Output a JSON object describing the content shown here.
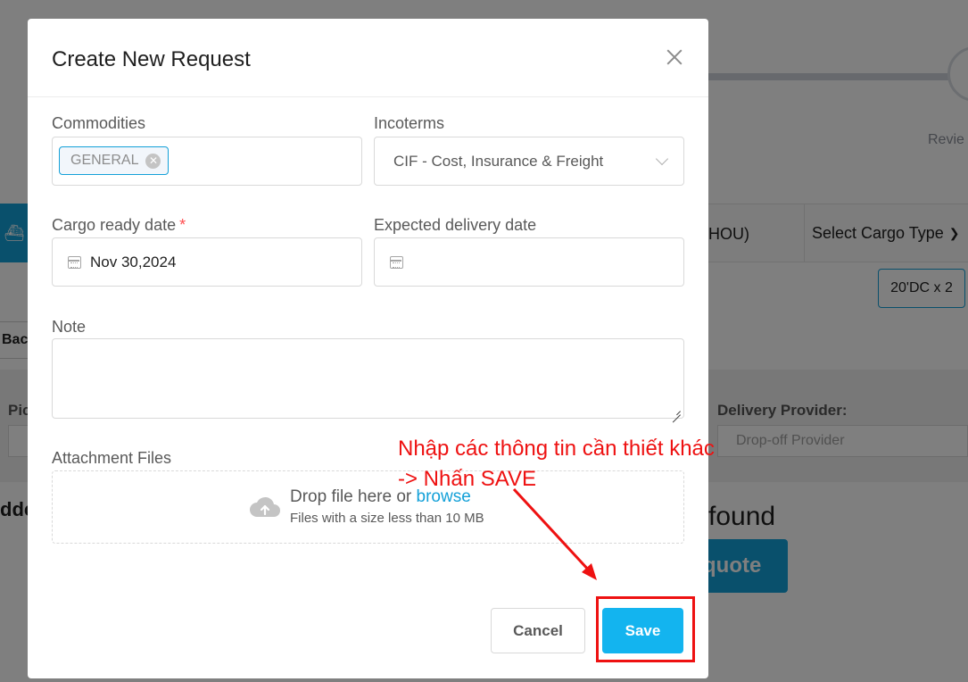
{
  "background": {
    "step_label": "Revie",
    "port_text": "HOU)",
    "cargo_type_select": "Select Cargo Type",
    "container_chip": "20'DC x 2",
    "back_button": "Bac",
    "pickup_label": "Pic",
    "delivery_provider_label": "Delivery Provider:",
    "delivery_provider_placeholder": "Drop-off Provider",
    "add_text": "ddc",
    "found_text": "found",
    "quote_button": "quote"
  },
  "modal": {
    "title": "Create New Request",
    "commodities": {
      "label": "Commodities",
      "tags": [
        "GENERAL"
      ]
    },
    "incoterms": {
      "label": "Incoterms",
      "value": "CIF - Cost, Insurance & Freight"
    },
    "cargo_ready_date": {
      "label": "Cargo ready date",
      "required_mark": "*",
      "value": "Nov 30,2024"
    },
    "expected_delivery_date": {
      "label": "Expected delivery date",
      "value": ""
    },
    "note": {
      "label": "Note",
      "value": ""
    },
    "attachment": {
      "label": "Attachment Files",
      "drop_text": "Drop file here or",
      "browse_link": "browse",
      "hint": "Files with a size less than 10 MB"
    },
    "buttons": {
      "cancel": "Cancel",
      "save": "Save"
    }
  },
  "annotation": {
    "line1": "Nhập các thông tin cần thiết khác",
    "line2": "-> Nhấn SAVE",
    "color": "#ee1111"
  },
  "colors": {
    "accent": "#13a0d8",
    "save_button": "#13b4ef",
    "required": "#ff4d4f"
  }
}
